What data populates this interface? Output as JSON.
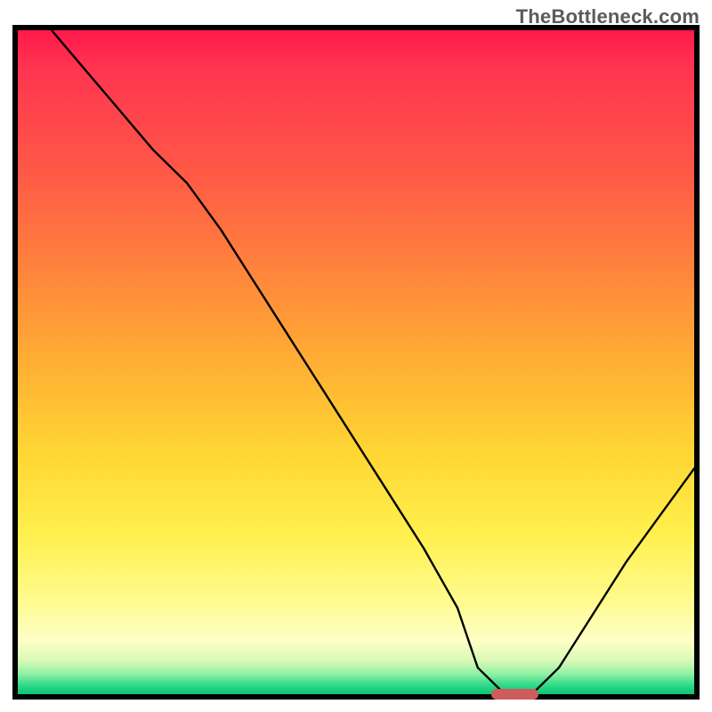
{
  "watermark": "TheBottleneck.com",
  "chart_data": {
    "type": "line",
    "title": "",
    "xlabel": "",
    "ylabel": "",
    "xlim": [
      0,
      100
    ],
    "ylim": [
      0,
      100
    ],
    "grid": false,
    "series": [
      {
        "name": "bottleneck-curve",
        "x": [
          5,
          10,
          15,
          20,
          25,
          30,
          35,
          40,
          45,
          50,
          55,
          60,
          65,
          68,
          72,
          76,
          80,
          85,
          90,
          95,
          100
        ],
        "y": [
          100,
          94,
          88,
          82,
          77,
          70,
          62,
          54,
          46,
          38,
          30,
          22,
          13,
          4,
          0,
          0,
          4,
          12,
          20,
          27,
          34
        ]
      }
    ],
    "minimum_marker": {
      "x_start": 70,
      "x_end": 77,
      "y": 0
    },
    "gradient_stops": [
      {
        "pos": 0,
        "color": "#ff1a4b"
      },
      {
        "pos": 0.22,
        "color": "#ff5a46"
      },
      {
        "pos": 0.52,
        "color": "#ffb433"
      },
      {
        "pos": 0.76,
        "color": "#fff04d"
      },
      {
        "pos": 0.92,
        "color": "#fdffc7"
      },
      {
        "pos": 0.97,
        "color": "#8ef0a3"
      },
      {
        "pos": 1.0,
        "color": "#0bc477"
      }
    ]
  },
  "marker_color": "#cd5c5c"
}
